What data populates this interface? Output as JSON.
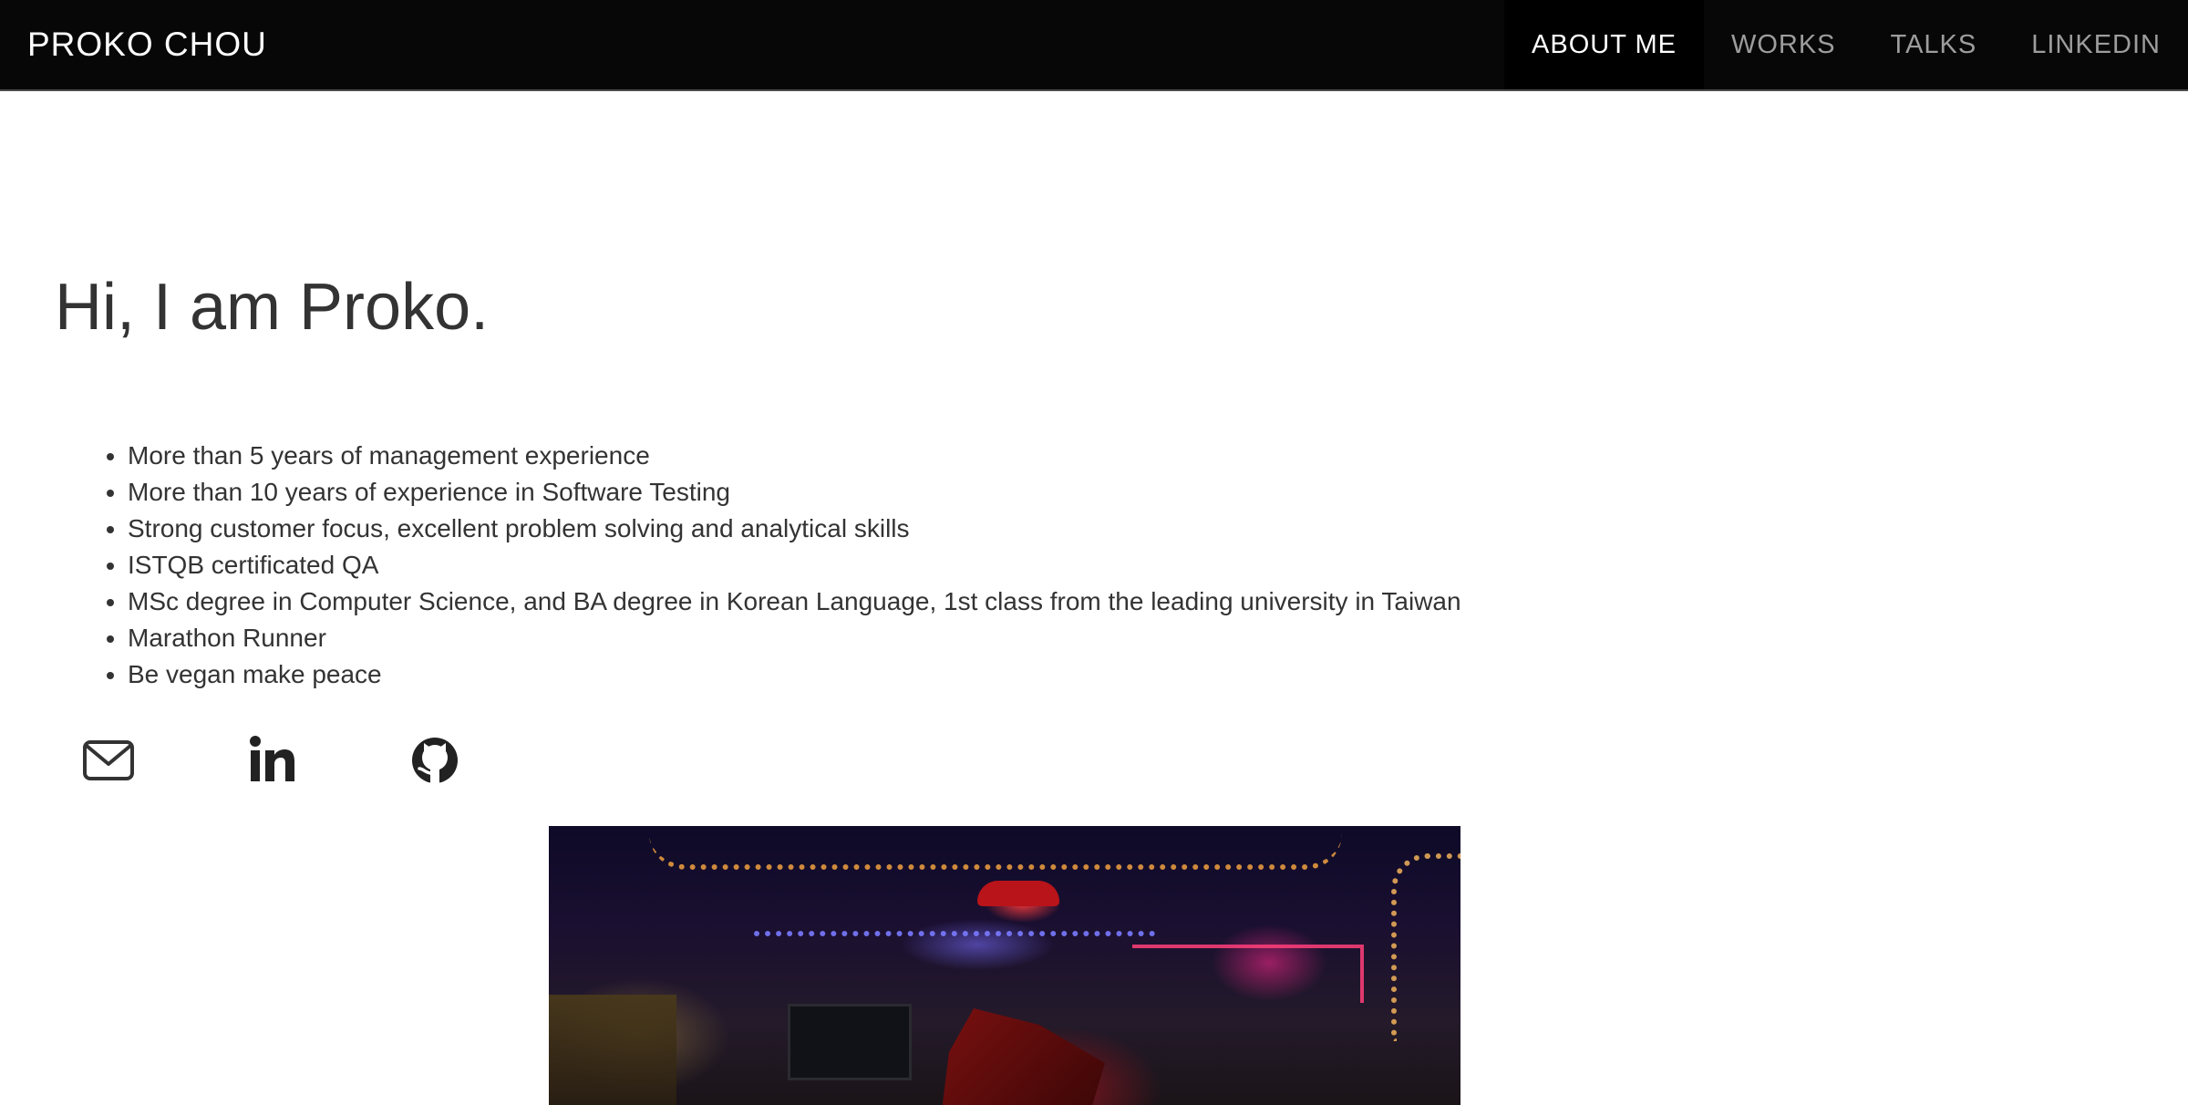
{
  "nav": {
    "brand": "PROKO CHOU",
    "items": [
      {
        "label": "ABOUT ME",
        "active": true
      },
      {
        "label": "WORKS",
        "active": false
      },
      {
        "label": "TALKS",
        "active": false
      },
      {
        "label": "LINKEDIN",
        "active": false
      }
    ]
  },
  "intro": {
    "headline": "Hi, I am Proko.",
    "highlights": [
      "More than 5 years of management experience",
      "More than 10 years of experience in Software Testing",
      "Strong customer focus, excellent problem solving and analytical skills",
      "ISTQB certificated QA",
      "MSc degree in Computer Science, and BA degree in Korean Language, 1st class from the leading university in Taiwan",
      "Marathon Runner",
      "Be vegan make peace"
    ]
  },
  "socials": [
    {
      "icon": "envelope-icon"
    },
    {
      "icon": "linkedin-icon"
    },
    {
      "icon": "github-icon"
    }
  ],
  "colors": {
    "navbar_bg": "#070707",
    "nav_active_text": "#ffffff",
    "nav_inactive_text": "#9d9d9d",
    "body_text": "#333333"
  }
}
